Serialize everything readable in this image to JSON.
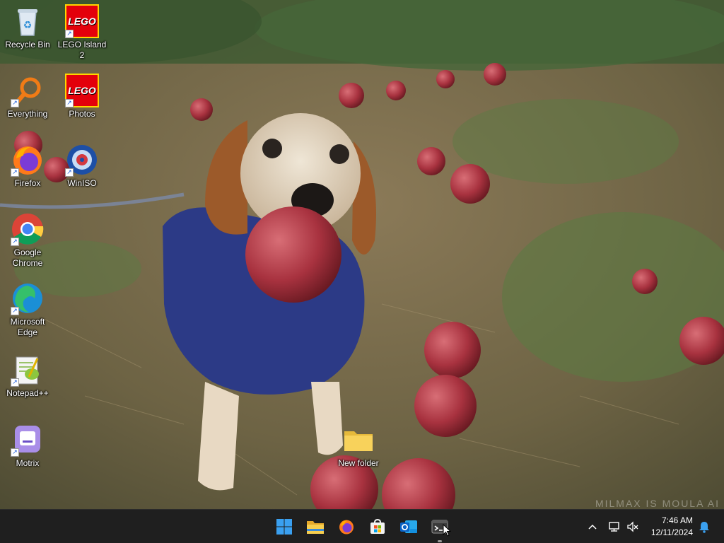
{
  "desktop": {
    "icons": [
      {
        "label": "Recycle Bin",
        "icon": "recycle-bin-icon"
      },
      {
        "label": "LEGO Island 2",
        "icon": "lego-icon"
      },
      {
        "label": "Everything",
        "icon": "everything-search-icon"
      },
      {
        "label": "Photos",
        "icon": "lego-icon"
      },
      {
        "label": "Firefox",
        "icon": "firefox-icon"
      },
      {
        "label": "WinISO",
        "icon": "winiso-icon"
      },
      {
        "label": "Google Chrome",
        "icon": "chrome-icon"
      },
      {
        "label": "Microsoft Edge",
        "icon": "edge-icon"
      },
      {
        "label": "Notepad++",
        "icon": "notepadpp-icon"
      },
      {
        "label": "Motrix",
        "icon": "motrix-icon"
      },
      {
        "label": "New folder",
        "icon": "folder-icon"
      }
    ],
    "logo_text": "LEGO",
    "wallpaper_watermark": "MILMAX IS MOULA AI"
  },
  "taskbar": {
    "apps": [
      "start",
      "file-explorer",
      "firefox",
      "microsoft-store",
      "outlook",
      "terminal"
    ],
    "time": "7:46 AM",
    "date": "12/11/2024"
  },
  "colors": {
    "taskbar_bg": "#1f1f1f",
    "accent": "#0a84ff"
  }
}
